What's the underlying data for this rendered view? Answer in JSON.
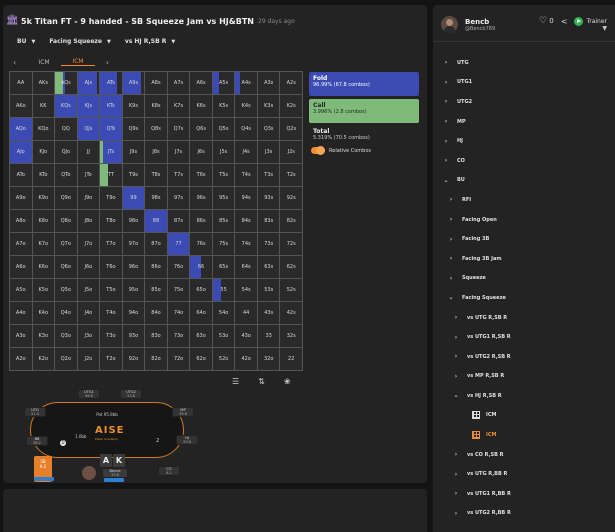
{
  "header": {
    "title": "5k Titan FT - 9 handed - SB Squeeze Jam vs HJ&BTN",
    "age": "29 days ago",
    "likes": "0",
    "trainer_label": "Trainer"
  },
  "filters": [
    {
      "label": "BU"
    },
    {
      "label": "Facing Squeeze"
    },
    {
      "label": "vs HJ R,SB R"
    }
  ],
  "icm_tabs": [
    "ICM",
    "ICM"
  ],
  "colors": {
    "fold": "#3c4ab3",
    "call": "#7fba7b",
    "accent": "#f08c32"
  },
  "hands": [
    [
      "AA",
      "AKs",
      "AQs",
      "AJs",
      "ATs",
      "A9s",
      "A8s",
      "A7s",
      "A6s",
      "A5s",
      "A4s",
      "A3s",
      "A2s"
    ],
    [
      "AKo",
      "KK",
      "KQs",
      "KJs",
      "KTs",
      "K9s",
      "K8s",
      "K7s",
      "K6s",
      "K5s",
      "K4s",
      "K3s",
      "K2s"
    ],
    [
      "AQo",
      "KQo",
      "QQ",
      "QJs",
      "QTs",
      "Q9s",
      "Q8s",
      "Q7s",
      "Q6s",
      "Q5s",
      "Q4s",
      "Q3s",
      "Q2s"
    ],
    [
      "AJo",
      "KJo",
      "QJo",
      "JJ",
      "JTs",
      "J9s",
      "J8s",
      "J7s",
      "J6s",
      "J5s",
      "J4s",
      "J3s",
      "J2s"
    ],
    [
      "ATo",
      "KTo",
      "QTo",
      "JTo",
      "TT",
      "T9s",
      "T8s",
      "T7s",
      "T6s",
      "T5s",
      "T4s",
      "T3s",
      "T2s"
    ],
    [
      "A9o",
      "K9o",
      "Q9o",
      "J9o",
      "T9o",
      "99",
      "98s",
      "97s",
      "96s",
      "95s",
      "94s",
      "93s",
      "92s"
    ],
    [
      "A8o",
      "K8o",
      "Q8o",
      "J8o",
      "T8o",
      "98o",
      "88",
      "87s",
      "86s",
      "85s",
      "84s",
      "83s",
      "82s"
    ],
    [
      "A7o",
      "K7o",
      "Q7o",
      "J7o",
      "T7o",
      "97o",
      "87o",
      "77",
      "76s",
      "75s",
      "74s",
      "73s",
      "72s"
    ],
    [
      "A6o",
      "K6o",
      "Q6o",
      "J6o",
      "T6o",
      "96o",
      "86o",
      "76o",
      "66",
      "65s",
      "64s",
      "63s",
      "62s"
    ],
    [
      "A5o",
      "K5o",
      "Q5o",
      "J5o",
      "T5o",
      "95o",
      "85o",
      "75o",
      "65o",
      "55",
      "54s",
      "53s",
      "52s"
    ],
    [
      "A4o",
      "K4o",
      "Q4o",
      "J4o",
      "T4o",
      "94o",
      "84o",
      "74o",
      "64o",
      "54o",
      "44",
      "43s",
      "42s"
    ],
    [
      "A3o",
      "K3o",
      "Q3o",
      "J3o",
      "T3o",
      "93o",
      "83o",
      "73o",
      "63o",
      "53o",
      "43o",
      "33",
      "32s"
    ],
    [
      "A2o",
      "K2o",
      "Q2o",
      "J2o",
      "T2o",
      "92o",
      "82o",
      "72o",
      "62o",
      "52o",
      "42o",
      "32o",
      "22"
    ]
  ],
  "strategy": [
    {
      "r": 0,
      "c": 1,
      "fold": 0.0,
      "call": 0.0
    },
    {
      "r": 0,
      "c": 2,
      "fold": 0.1,
      "call": 0.35
    },
    {
      "r": 0,
      "c": 3,
      "fold": 0.9,
      "call": 0.0
    },
    {
      "r": 0,
      "c": 4,
      "fold": 0.8,
      "call": 0.0
    },
    {
      "r": 0,
      "c": 5,
      "fold": 0.85,
      "call": 0.0
    },
    {
      "r": 0,
      "c": 9,
      "fold": 0.3,
      "call": 0.0
    },
    {
      "r": 0,
      "c": 10,
      "fold": 0.2,
      "call": 0.0
    },
    {
      "r": 1,
      "c": 2,
      "fold": 1.0,
      "call": 0.0
    },
    {
      "r": 1,
      "c": 3,
      "fold": 1.0,
      "call": 0.0
    },
    {
      "r": 1,
      "c": 4,
      "fold": 1.0,
      "call": 0.0
    },
    {
      "r": 2,
      "c": 0,
      "fold": 1.0,
      "call": 0.0
    },
    {
      "r": 2,
      "c": 3,
      "fold": 1.0,
      "call": 0.0
    },
    {
      "r": 2,
      "c": 4,
      "fold": 1.0,
      "call": 0.0
    },
    {
      "r": 3,
      "c": 0,
      "fold": 1.0,
      "call": 0.0
    },
    {
      "r": 3,
      "c": 4,
      "fold": 0.85,
      "call": 0.15
    },
    {
      "r": 4,
      "c": 4,
      "fold": 0.0,
      "call": 0.35
    },
    {
      "r": 5,
      "c": 5,
      "fold": 1.0,
      "call": 0.0
    },
    {
      "r": 6,
      "c": 6,
      "fold": 1.0,
      "call": 0.0
    },
    {
      "r": 7,
      "c": 7,
      "fold": 1.0,
      "call": 0.0
    },
    {
      "r": 8,
      "c": 8,
      "fold": 0.5,
      "call": 0.0
    },
    {
      "r": 9,
      "c": 9,
      "fold": 0.4,
      "call": 0.0
    }
  ],
  "legend": {
    "fold": {
      "name": "Fold",
      "value": "96.99% (67.8 combos)"
    },
    "call": {
      "name": "Call",
      "value": "3.996% (2.8 combos)"
    },
    "total": {
      "name": "Total",
      "value": "5.319% (70.5 combos)"
    },
    "toggle_label": "Relative Combos"
  },
  "table": {
    "pot": "Pot 95.9bb",
    "sb_bet": "1.0bb",
    "logo": "AISE",
    "logo_sub": "Poker Academy",
    "seats": [
      {
        "name": "UTG1",
        "stack": "46.6"
      },
      {
        "name": "UTG2",
        "stack": "53.8"
      },
      {
        "name": "UTG",
        "stack": "21.4"
      },
      {
        "name": "MP",
        "stack": "39.6"
      },
      {
        "name": "BB",
        "stack": "38.2"
      },
      {
        "name": "HJ",
        "stack": "29.8"
      },
      {
        "name": "CO",
        "stack": "8.2"
      }
    ],
    "sb_seat": {
      "name": "SB",
      "stack": "9.2"
    },
    "hero": {
      "name": "Bencb",
      "stack": "33.6"
    },
    "cards": [
      "A",
      "K"
    ],
    "num_left": "4",
    "num_right": "2"
  },
  "user": {
    "name": "Bencb",
    "handle": "@Bencb789"
  },
  "tree": [
    {
      "label": "UTG",
      "depth": 0,
      "open": false
    },
    {
      "label": "UTG1",
      "depth": 0,
      "open": false
    },
    {
      "label": "UTG2",
      "depth": 0,
      "open": false
    },
    {
      "label": "MP",
      "depth": 0,
      "open": false
    },
    {
      "label": "HJ",
      "depth": 0,
      "open": false
    },
    {
      "label": "CO",
      "depth": 0,
      "open": false
    },
    {
      "label": "BU",
      "depth": 0,
      "open": true
    },
    {
      "label": "RFI",
      "depth": 1,
      "open": false
    },
    {
      "label": "Facing Open",
      "depth": 1,
      "open": false
    },
    {
      "label": "Facing 3B",
      "depth": 1,
      "open": false
    },
    {
      "label": "Facing 3B Jam",
      "depth": 1,
      "open": false
    },
    {
      "label": "Squeeze",
      "depth": 1,
      "open": false
    },
    {
      "label": "Facing Squeeze",
      "depth": 1,
      "open": true
    },
    {
      "label": "vs UTG R,SB R",
      "depth": 2,
      "open": false
    },
    {
      "label": "vs UTG1 R,SB R",
      "depth": 2,
      "open": false
    },
    {
      "label": "vs UTG2 R,SB R",
      "depth": 2,
      "open": false
    },
    {
      "label": "vs MP R,SB R",
      "depth": 2,
      "open": false
    },
    {
      "label": "vs HJ R,SB R",
      "depth": 2,
      "open": true
    },
    {
      "label": "ICM",
      "depth": 3,
      "leaf": true,
      "icon": "white"
    },
    {
      "label": "ICM",
      "depth": 3,
      "leaf": true,
      "icon": "orange"
    },
    {
      "label": "vs CO R,SB R",
      "depth": 2,
      "open": false
    },
    {
      "label": "vs UTG R,BB R",
      "depth": 2,
      "open": false
    },
    {
      "label": "vs UTG1 R,BB R",
      "depth": 2,
      "open": false
    },
    {
      "label": "vs UTG2 R,BB R",
      "depth": 2,
      "open": false
    }
  ]
}
